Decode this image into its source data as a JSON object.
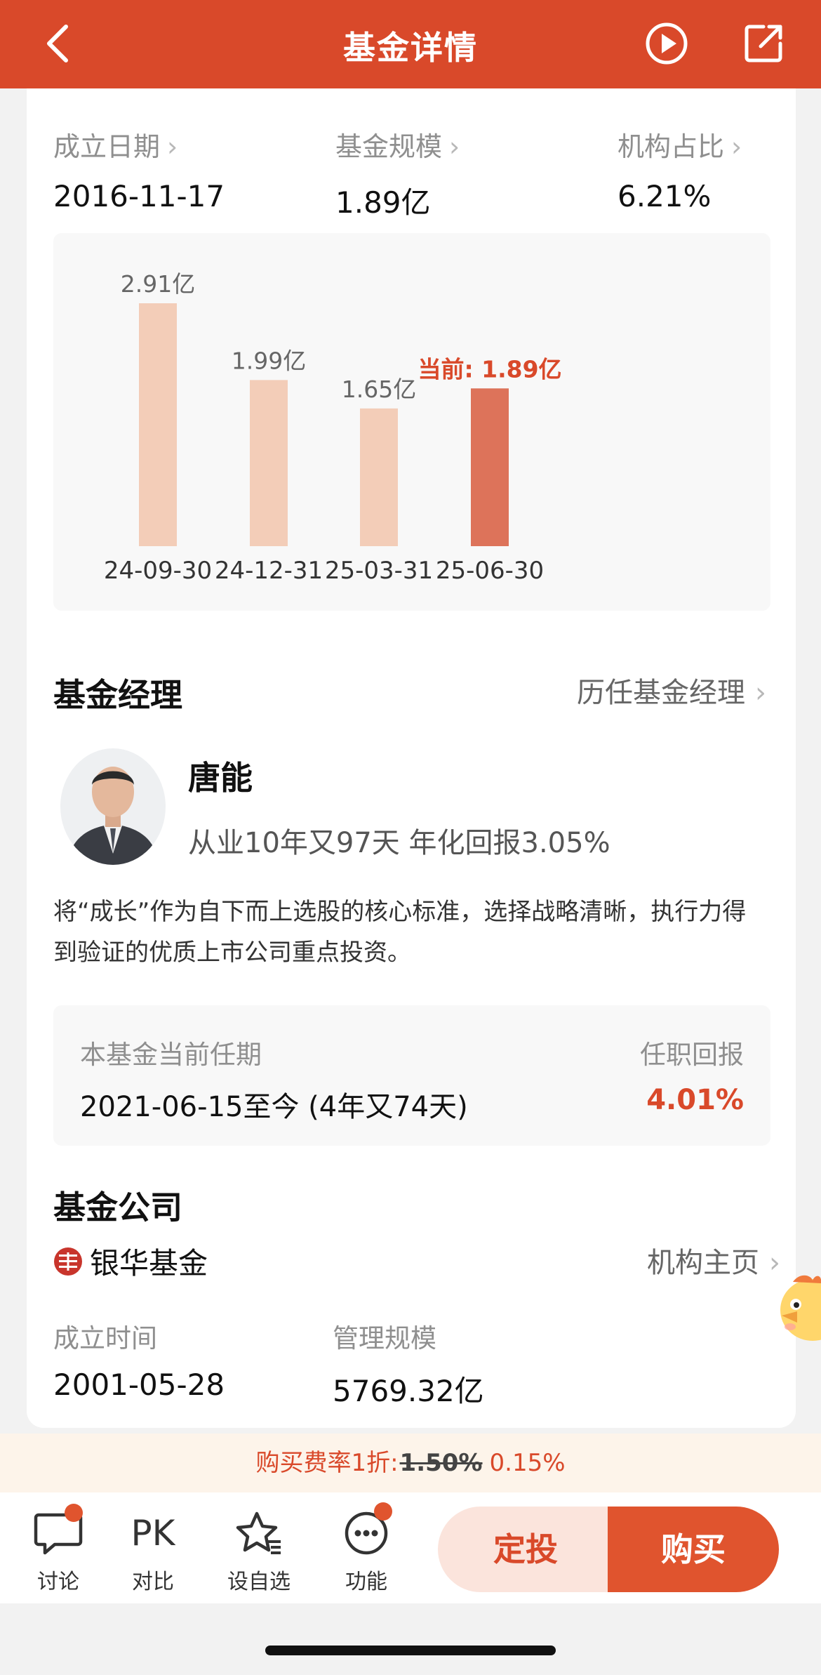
{
  "header": {
    "title": "基金详情"
  },
  "stats": [
    {
      "label": "成立日期",
      "value": "2016-11-17"
    },
    {
      "label": "基金规模",
      "value": "1.89亿"
    },
    {
      "label": "机构占比",
      "value": "6.21%"
    }
  ],
  "chart_data": {
    "type": "bar",
    "categories": [
      "24-09-30",
      "24-12-31",
      "25-03-31",
      "25-06-30"
    ],
    "values": [
      2.91,
      1.99,
      1.65,
      1.89
    ],
    "labels": [
      "2.91亿",
      "1.99亿",
      "1.65亿",
      "当前: 1.89亿"
    ],
    "unit": "亿",
    "colors": {
      "bar": "#f3cdb8",
      "current": "#dd735a",
      "label": "#666666",
      "current_label": "#d9492a"
    }
  },
  "manager_section": {
    "title": "基金经理",
    "history_link": "历任基金经理",
    "name": "唐能",
    "summary": "从业10年又97天 年化回报3.05%",
    "description": "将“成长”作为自下而上选股的核心标准，选择战略清晰，执行力得到验证的优质上市公司重点投资。",
    "tenure_label": "本基金当前任期",
    "tenure_value": "2021-06-15至今 (4年又74天)",
    "return_label": "任职回报",
    "return_value": "4.01%"
  },
  "company_section": {
    "title": "基金公司",
    "name": "银华基金",
    "home_link": "机构主页",
    "founded_label": "成立时间",
    "founded_value": "2001-05-28",
    "aum_label": "管理规模",
    "aum_value": "5769.32亿"
  },
  "fee": {
    "prefix": "购买费率1折:",
    "original": "1.50%",
    "discounted": "0.15%"
  },
  "toolbar": {
    "items": [
      {
        "label": "讨论",
        "icon": "chat-icon"
      },
      {
        "label": "对比",
        "icon": "PK"
      },
      {
        "label": "设自选",
        "icon": "star-list-icon"
      },
      {
        "label": "功能",
        "icon": "more-icon"
      }
    ],
    "sip_label": "定投",
    "buy_label": "购买"
  },
  "theme": {
    "accent": "#d9492a"
  }
}
